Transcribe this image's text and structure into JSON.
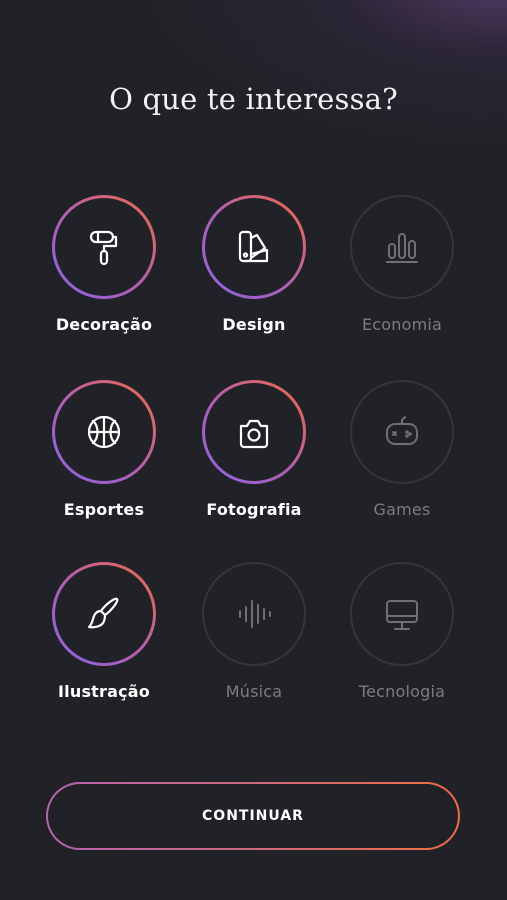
{
  "title": "O que te interessa?",
  "categories": [
    {
      "label": "Decoração",
      "icon": "paint-roller-icon",
      "selected": true
    },
    {
      "label": "Design",
      "icon": "color-swatch-icon",
      "selected": true
    },
    {
      "label": "Economia",
      "icon": "bar-chart-icon",
      "selected": false
    },
    {
      "label": "Esportes",
      "icon": "basketball-icon",
      "selected": true
    },
    {
      "label": "Fotografia",
      "icon": "camera-icon",
      "selected": true
    },
    {
      "label": "Games",
      "icon": "gamepad-icon",
      "selected": false
    },
    {
      "label": "Ilustração",
      "icon": "paintbrush-icon",
      "selected": true
    },
    {
      "label": "Música",
      "icon": "sound-wave-icon",
      "selected": false
    },
    {
      "label": "Tecnologia",
      "icon": "monitor-icon",
      "selected": false
    }
  ],
  "continue_label": "CONTINUAR",
  "colors": {
    "background": "#212227",
    "gradient_start": "#8a63e8",
    "gradient_end": "#f06b42",
    "inactive": "#7b7c82"
  }
}
